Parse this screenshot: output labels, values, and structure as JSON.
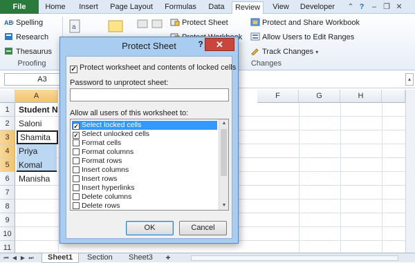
{
  "ribbon_tabs": [
    "File",
    "Home",
    "Insert",
    "Page Layout",
    "Formulas",
    "Data",
    "Review",
    "View",
    "Developer"
  ],
  "active_tab": "Review",
  "proofing": {
    "items": [
      "Spelling",
      "Research",
      "Thesaurus"
    ],
    "label": "Proofing"
  },
  "changes": {
    "protect_sheet": "Protect Sheet",
    "protect_workbook": "Protect Workbook",
    "share_workbook_partial": "k",
    "protect_and_share": "Protect and Share Workbook",
    "allow_users": "Allow Users to Edit Ranges",
    "track_changes": "Track Changes",
    "label": "Changes"
  },
  "formula_bar": {
    "name_box": "A3"
  },
  "columns": [
    "A",
    "F",
    "G",
    "H"
  ],
  "rows": [
    "1",
    "2",
    "3",
    "4",
    "5",
    "6",
    "7",
    "8",
    "9",
    "10",
    "11",
    "12"
  ],
  "cells": {
    "a1": "Student N",
    "a2": "Saloni",
    "a3": "Shamita",
    "a4": "Priya",
    "a5": "Komal",
    "a6": "Manisha"
  },
  "sheets": [
    "Sheet1",
    "Section",
    "Sheet3"
  ],
  "active_sheet": "Sheet1",
  "dialog": {
    "title": "Protect Sheet",
    "help": "?",
    "close": "✕",
    "protect_label": "Protect worksheet and contents of locked cells",
    "protect_checked": true,
    "password_label": "Password to unprotect sheet:",
    "password_value": "",
    "allow_label": "Allow all users of this worksheet to:",
    "options": [
      {
        "label": "Select locked cells",
        "checked": true
      },
      {
        "label": "Select unlocked cells",
        "checked": true
      },
      {
        "label": "Format cells",
        "checked": false
      },
      {
        "label": "Format columns",
        "checked": false
      },
      {
        "label": "Format rows",
        "checked": false
      },
      {
        "label": "Insert columns",
        "checked": false
      },
      {
        "label": "Insert rows",
        "checked": false
      },
      {
        "label": "Insert hyperlinks",
        "checked": false
      },
      {
        "label": "Delete columns",
        "checked": false
      },
      {
        "label": "Delete rows",
        "checked": false
      }
    ],
    "ok": "OK",
    "cancel": "Cancel"
  }
}
